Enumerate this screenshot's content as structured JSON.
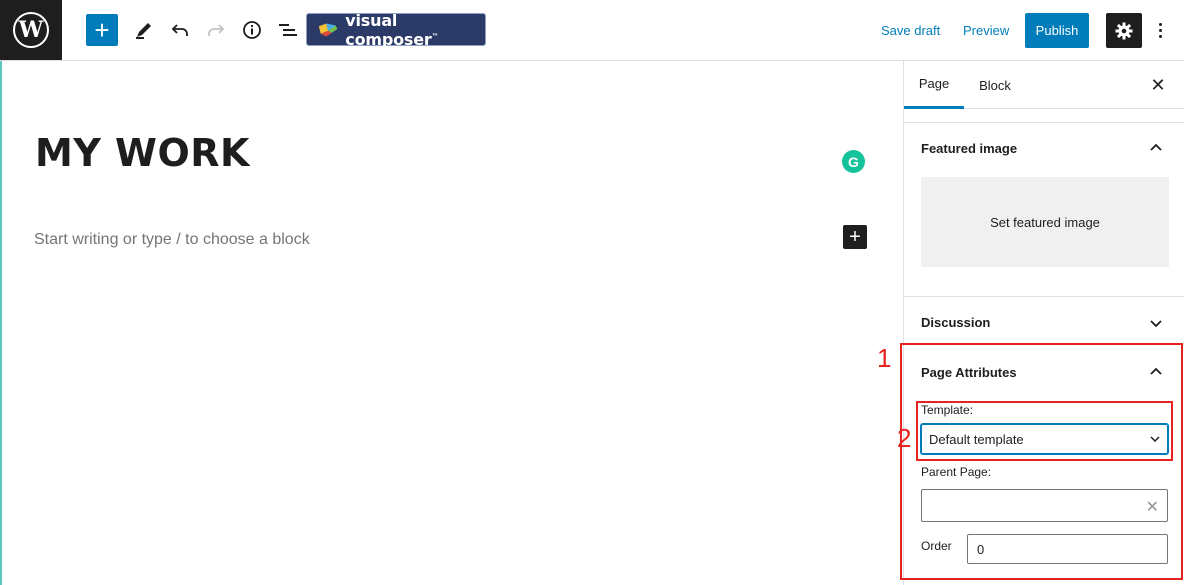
{
  "topbar": {
    "logo_glyph": "W",
    "add_glyph": "+",
    "visual_composer_label": "visual composer",
    "visual_composer_tm": "™",
    "save_draft": "Save draft",
    "preview": "Preview",
    "publish": "Publish",
    "accent_color": "#007cba"
  },
  "editor": {
    "title": "MY WORK",
    "placeholder": "Start writing or type / to choose a block",
    "grammarly_glyph": "G",
    "inserter_glyph": "+"
  },
  "sidebar": {
    "tabs": [
      {
        "label": "Page"
      },
      {
        "label": "Block"
      }
    ],
    "close_glyph": "✕",
    "featured_image": {
      "title": "Featured image",
      "button": "Set featured image"
    },
    "discussion": {
      "title": "Discussion"
    },
    "page_attributes": {
      "title": "Page Attributes",
      "template_label": "Template:",
      "template_value": "Default template",
      "parent_label": "Parent Page:",
      "parent_value": "",
      "parent_clear_glyph": "✕",
      "order_label": "Order",
      "order_value": "0"
    }
  },
  "annotations": {
    "color": "#e8231f",
    "labels": [
      "1",
      "2"
    ]
  }
}
